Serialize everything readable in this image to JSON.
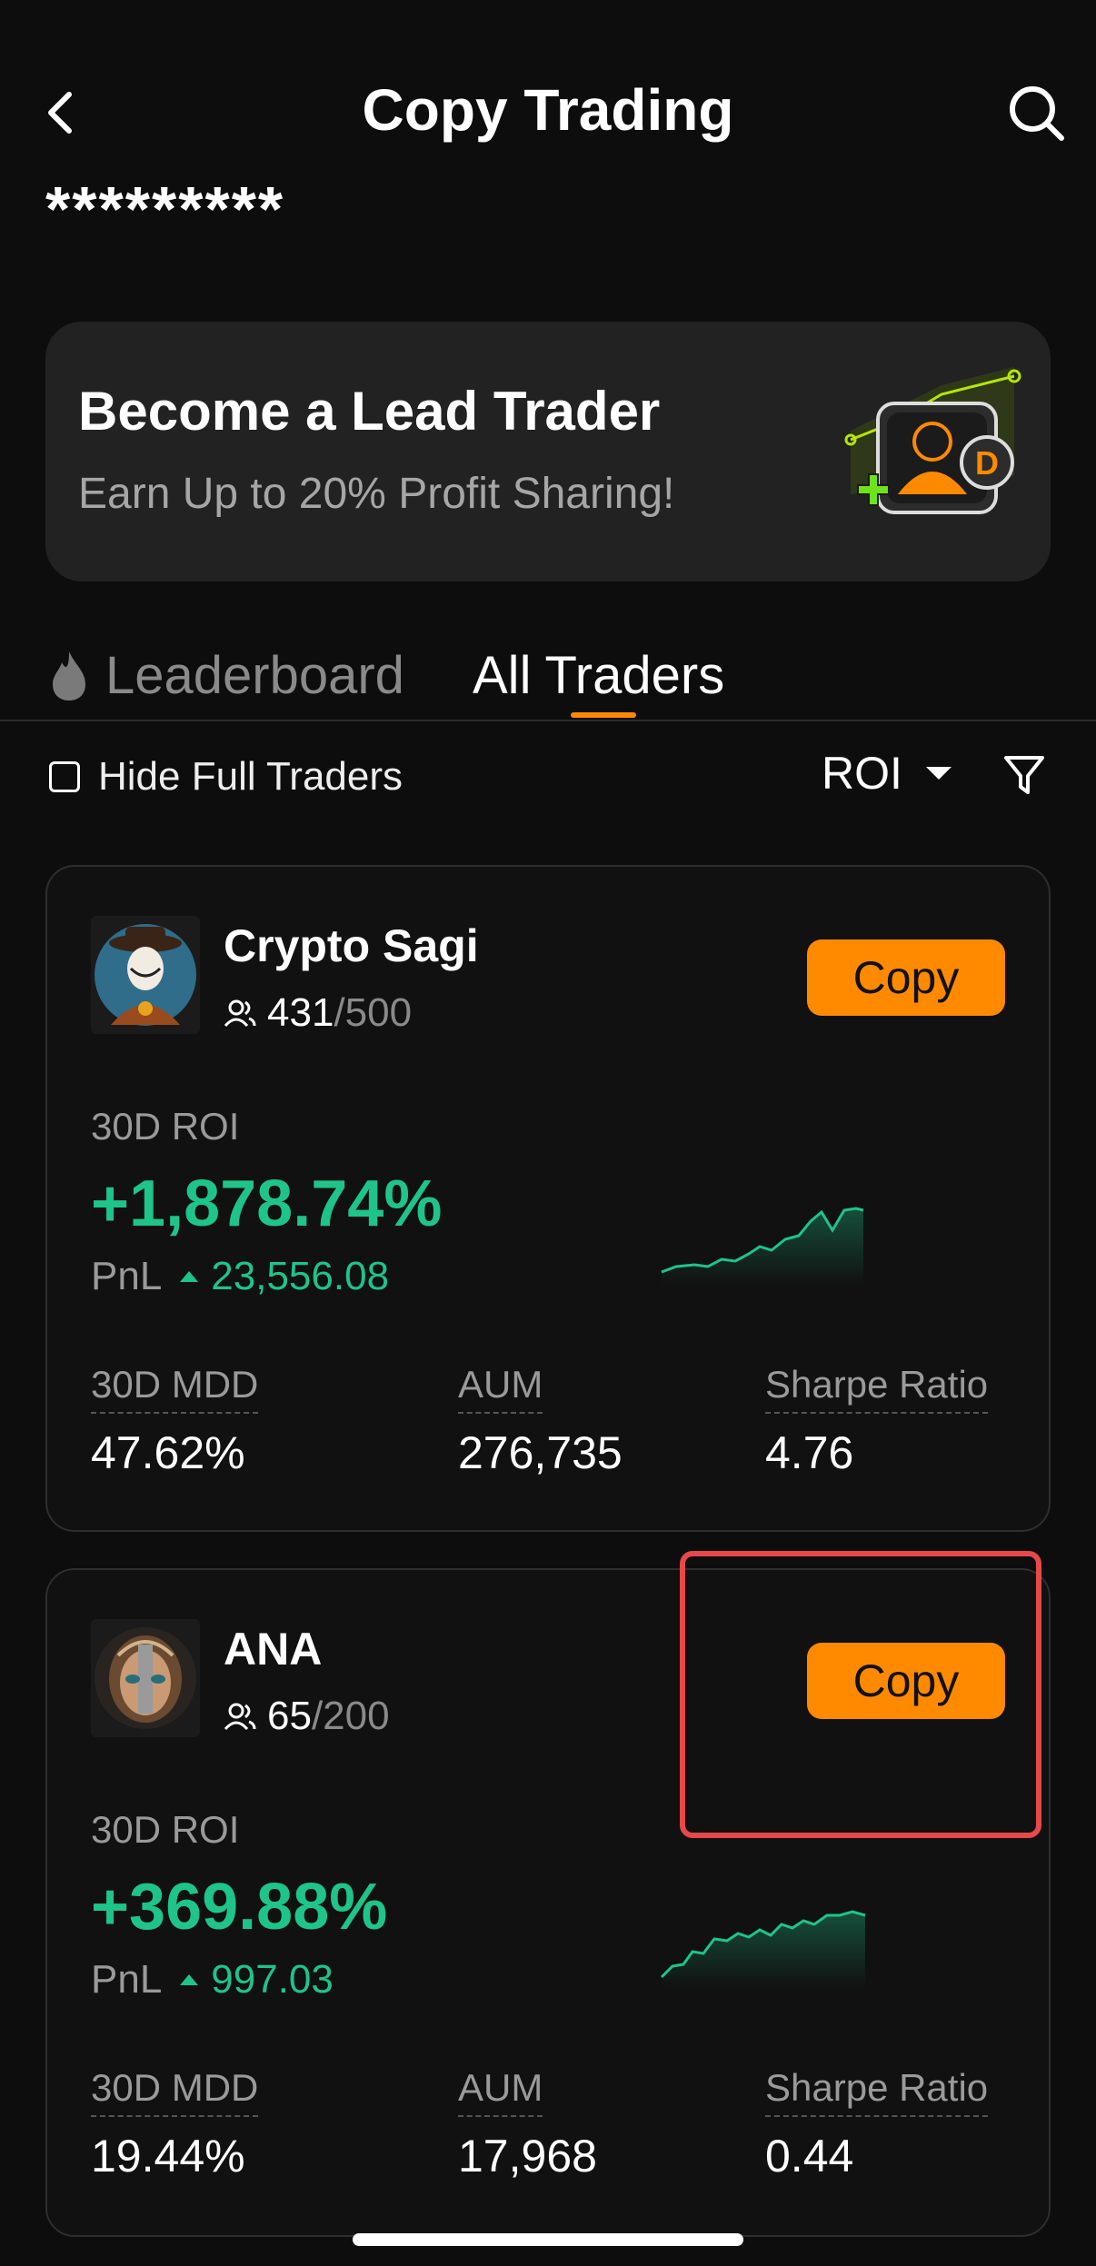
{
  "header": {
    "title": "Copy Trading"
  },
  "account": {
    "masked_name": "*********"
  },
  "banner": {
    "title": "Become a Lead Trader",
    "subtitle": "Earn Up to 20% Profit Sharing!"
  },
  "tabs": [
    {
      "label": "Leaderboard",
      "active": false
    },
    {
      "label": "All Traders",
      "active": true
    }
  ],
  "filters": {
    "hide_full_label": "Hide Full Traders",
    "hide_full_checked": false,
    "sort_label": "ROI"
  },
  "traders": [
    {
      "name": "Crypto Sagi",
      "followers": "431",
      "followers_cap": "/500",
      "copy_label": "Copy",
      "roi_label": "30D ROI",
      "roi": "+1,878.74%",
      "pnl_label": "PnL",
      "pnl": "23,556.08",
      "stats": [
        {
          "label": "30D MDD",
          "value": "47.62%"
        },
        {
          "label": "AUM",
          "value": "276,735"
        },
        {
          "label": "Sharpe Ratio",
          "value": "4.76"
        }
      ]
    },
    {
      "name": "ANA",
      "followers": "65",
      "followers_cap": "/200",
      "copy_label": "Copy",
      "roi_label": "30D ROI",
      "roi": "+369.88%",
      "pnl_label": "PnL",
      "pnl": "997.03",
      "stats": [
        {
          "label": "30D MDD",
          "value": "19.44%"
        },
        {
          "label": "AUM",
          "value": "17,968"
        },
        {
          "label": "Sharpe Ratio",
          "value": "0.44"
        }
      ]
    }
  ],
  "colors": {
    "accent": "#ff8a00",
    "positive": "#1ec48a",
    "highlight": "#e8484a",
    "background": "#0d0d0d"
  },
  "icons": [
    "back-arrow-icon",
    "search-icon",
    "flame-icon",
    "checkbox-icon",
    "caret-down-icon",
    "filter-icon",
    "users-icon",
    "up-triangle-icon"
  ]
}
